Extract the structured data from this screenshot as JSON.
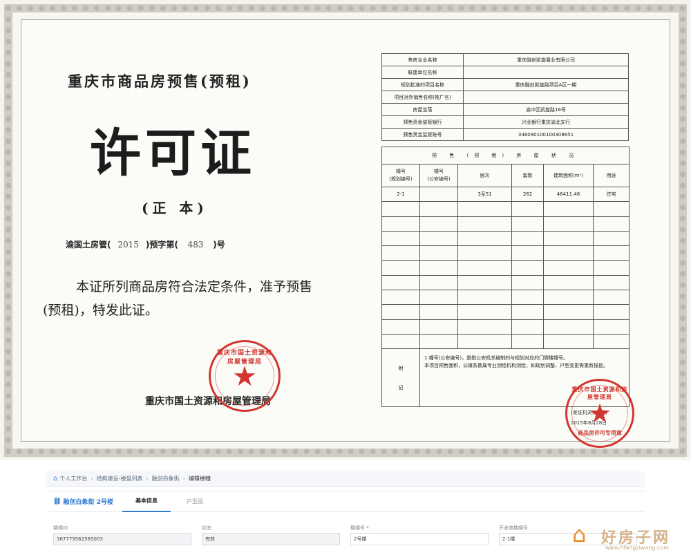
{
  "certificate": {
    "title_top": "重庆市商品房预售(预租)",
    "title_main": "许可证",
    "title_sub": "(正 本)",
    "permit_number": {
      "prefix": "渝国土房管(",
      "year": "2015",
      "middle": ")预字第(",
      "number": "483",
      "suffix": ")号"
    },
    "statement": "本证所列商品房符合法定条件，准予预售(预租)，特发此证。",
    "issuer": "重庆市国土资源和房屋管理局",
    "seal_left": {
      "text": "重庆市国土资源和房屋管理局"
    },
    "seal_right": {
      "text": "重庆市国土资源和房屋管理局",
      "sub": "商品房许可专用章"
    },
    "info_rows": [
      {
        "label": "售房企业名称",
        "value": "重庆融创凯旋置业有限公司"
      },
      {
        "label": "联建单位名称",
        "value": ""
      },
      {
        "label": "规划批准的项目名称",
        "value": "重庆融创凯旋路项目A区一期"
      },
      {
        "label": "项目对外销售名称(推广名)",
        "value": ""
      },
      {
        "label": "房屋坐落",
        "value": "渝中区凯旋路16号"
      },
      {
        "label": "预售资金监管银行",
        "value": "兴业银行重庆渝北支行"
      },
      {
        "label": "预售资金监管账号",
        "value": "346090100100308651"
      }
    ],
    "sale_heading": "预 售 (预 租) 房 屋 状 况",
    "sale_columns": [
      "幢号\n(规划编号)",
      "幢号\n(公安编号)",
      "层次",
      "套数",
      "建筑面积(m²)",
      "用途"
    ],
    "sale_rows": [
      [
        "2-1",
        "",
        "3至51",
        "262",
        "46411.48",
        "住宅"
      ]
    ],
    "note_label": "附\n\n记",
    "note_text": "1.幢号(公安编号)，是指公安机关编制的与规划对应的门牌楼幢号。\n本项目预售面积，公摊系数属专业测绘机构测绘，如规划调整、户型变更需重新报批。",
    "date_line1": "(发证机关)(盖章)",
    "date_line2": "2015年8月28日"
  },
  "ui": {
    "breadcrumb": [
      "个人工作台",
      "结构建设-楼盘列表",
      "融创白象街",
      "编辑楼幢"
    ],
    "building_link": "融创白象街 2号楼",
    "tabs": [
      "基本信息",
      "户型图"
    ],
    "fields": [
      {
        "label": "楼幢ID",
        "value": "367779562565003",
        "required": false,
        "editable": false
      },
      {
        "label": "状态",
        "value": "有效",
        "required": false,
        "editable": false
      },
      {
        "label": "楼幢号",
        "value": "2号楼",
        "required": true,
        "editable": true
      },
      {
        "label": "开发商楼幢号",
        "value": "2-1楼",
        "required": false,
        "editable": true
      }
    ]
  },
  "watermark": {
    "text": "好房子网",
    "url": "www.hfangziwang.com"
  }
}
